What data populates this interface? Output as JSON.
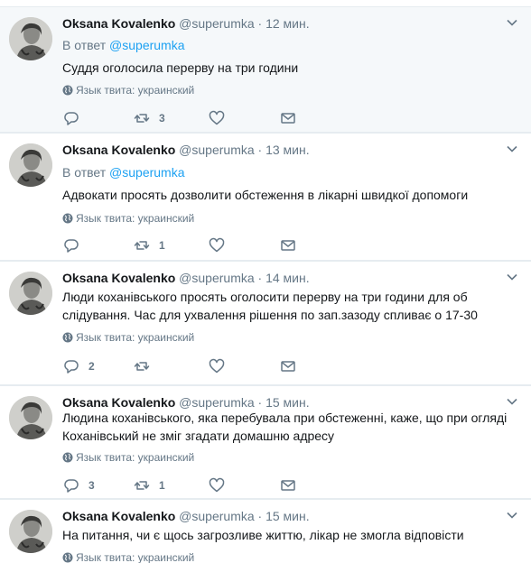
{
  "language_label": "Язык твита: украинский",
  "reply_prefix": "В ответ",
  "tweets": [
    {
      "name": "Oksana Kovalenko",
      "handle": "@superumka",
      "dot": "·",
      "time": "12 мин.",
      "reply_to": "@superumka",
      "text": "Суддя оголосила перерву на три години",
      "replies": "",
      "retweets": "3",
      "likes": ""
    },
    {
      "name": "Oksana Kovalenko",
      "handle": "@superumka",
      "dot": "·",
      "time": "13 мин.",
      "reply_to": "@superumka",
      "text": "Адвокати просять дозволити обстеження в лікарні швидкої допомоги",
      "replies": "",
      "retweets": "1",
      "likes": ""
    },
    {
      "name": "Oksana Kovalenko",
      "handle": "@superumka",
      "dot": "·",
      "time": "14 мин.",
      "text": "Люди коханівського просять оголосити перерву на три години для об слідування. Час для ухвалення рішення по зап.зазоду спливає о 17-30",
      "replies": "2",
      "retweets": "",
      "likes": ""
    },
    {
      "name": "Oksana Kovalenko",
      "handle": "@superumka",
      "dot": "·",
      "time": "15 мин.",
      "text": "Людина коханівського, яка перебувала при обстеженні, каже, що при огляді Коханівський не зміг згадати домашню адресу",
      "replies": "3",
      "retweets": "1",
      "likes": ""
    },
    {
      "name": "Oksana Kovalenko",
      "handle": "@superumka",
      "dot": "·",
      "time": "15 мин.",
      "text": "На питання, чи є щось загрозливе життю, лікар не змогла відповісти",
      "replies": "",
      "retweets": "",
      "likes": ""
    }
  ],
  "icons": {
    "reply": "reply-icon",
    "retweet": "retweet-icon",
    "like": "heart-icon",
    "dm": "envelope-icon",
    "caret": "chevron-down-icon",
    "globe": "globe-icon"
  },
  "colors": {
    "link": "#1da1f2",
    "secondary": "#657786",
    "highlight_bg": "#f5f8fa",
    "border": "#e6ecf0"
  }
}
